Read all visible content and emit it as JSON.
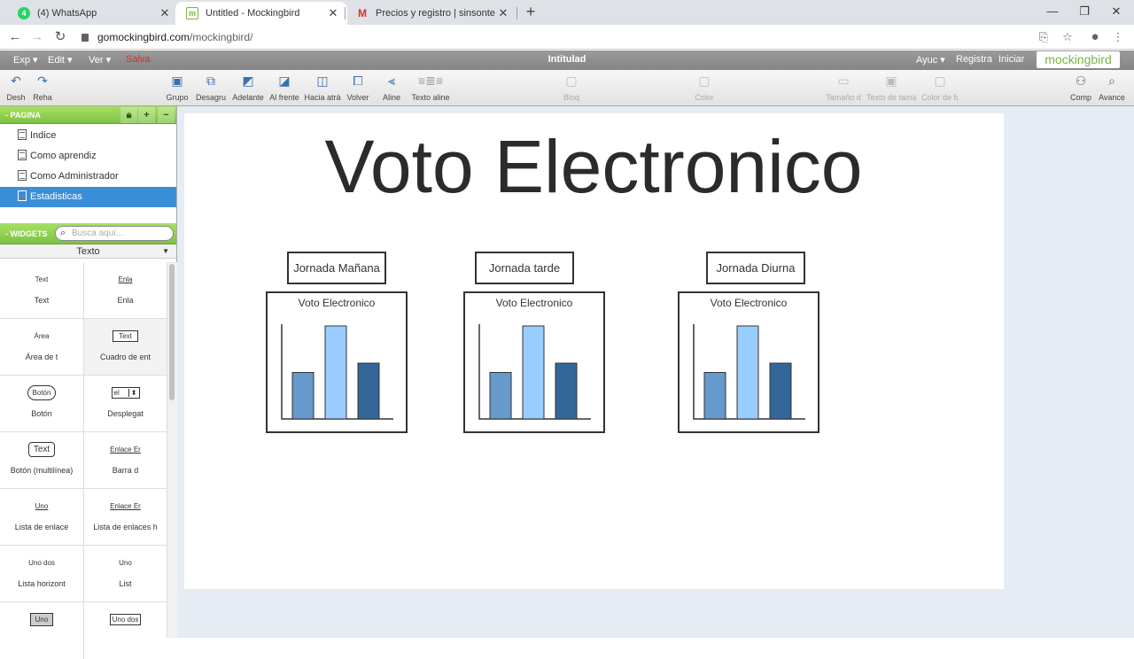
{
  "browser": {
    "tabs": [
      {
        "title": "(4) WhatsApp",
        "favicon": "whatsapp-icon",
        "badge": "4",
        "active": false
      },
      {
        "title": "Untitled - Mockingbird",
        "favicon": "mockingbird-icon",
        "badge": "m",
        "active": true
      },
      {
        "title": "Precios y registro | sinsonte",
        "favicon": "gmail-icon",
        "badge": "M",
        "active": false
      }
    ],
    "url_host": "gomockingbird.com",
    "url_path": "/mockingbird/"
  },
  "menubar": {
    "items": [
      "Exp ▾",
      "Edit ▾",
      "Ver ▾"
    ],
    "save_label": "Salva",
    "doc_title": "Intitulad",
    "right_items": [
      "Ayuc ▾",
      "Registra",
      "Iniciar"
    ],
    "brand": "mockingbird"
  },
  "toolbar": {
    "undo": "Desh",
    "redo": "Reha",
    "group": "Grupo",
    "ungroup": "Desagru",
    "forward": "Adelante",
    "to_front": "Al frente",
    "backward": "Hacia atrá",
    "to_back": "Volver",
    "align": "Aline",
    "text_align": "Texto aline",
    "lock": "Bloq",
    "color": "Color",
    "size": "Tamaño d",
    "text_size": "Texto de tama",
    "font_color": "Color de fu",
    "comp": "Comp",
    "advance": "Avance"
  },
  "pages": {
    "header": "PAGINA",
    "items": [
      "Indice",
      "Como aprendiz",
      "Como Administrador",
      "Estadisticas"
    ],
    "selected": "Estadisticas"
  },
  "widgets": {
    "header": "WIDGETS",
    "search_placeholder": "Busca aquí...",
    "category": "Texto",
    "items": [
      {
        "label": "Text",
        "preview": "Text"
      },
      {
        "label": "Enla",
        "preview": "Enla"
      },
      {
        "label": "Área de t",
        "preview": "Área"
      },
      {
        "label": "Cuadro de ent",
        "preview": "Text"
      },
      {
        "label": "Botón",
        "preview": "Botón"
      },
      {
        "label": "Desplegat",
        "preview": "el"
      },
      {
        "label": "Botón (multilínea)",
        "preview": "Text"
      },
      {
        "label": "Barra d",
        "preview": "Enlace Er"
      },
      {
        "label": "Lista de enlace",
        "preview": "Uno"
      },
      {
        "label": "Lista de enlaces h",
        "preview": "Enlace Er"
      },
      {
        "label": "Lista horizont",
        "preview": "Uno dos"
      },
      {
        "label": "List",
        "preview": "Uno"
      },
      {
        "label": "",
        "preview": "Uno"
      },
      {
        "label": "",
        "preview": "Uno dos"
      }
    ]
  },
  "canvas": {
    "title": "Voto Electronico",
    "labels": [
      "Jornada Mañana",
      "Jornada tarde",
      "Jornada Diurna"
    ],
    "chart_title": "Voto Electronico"
  },
  "chart_data": [
    {
      "type": "bar",
      "title": "Voto Electronico",
      "categories": [
        "",
        "",
        ""
      ],
      "values": [
        50,
        100,
        60
      ],
      "colors": [
        "#6699cc",
        "#99ccff",
        "#336699"
      ],
      "ylim": [
        0,
        100
      ]
    },
    {
      "type": "bar",
      "title": "Voto Electronico",
      "categories": [
        "",
        "",
        ""
      ],
      "values": [
        50,
        100,
        60
      ],
      "colors": [
        "#6699cc",
        "#99ccff",
        "#336699"
      ],
      "ylim": [
        0,
        100
      ]
    },
    {
      "type": "bar",
      "title": "Voto Electronico",
      "categories": [
        "",
        "",
        ""
      ],
      "values": [
        50,
        100,
        60
      ],
      "colors": [
        "#6699cc",
        "#99ccff",
        "#336699"
      ],
      "ylim": [
        0,
        100
      ]
    }
  ]
}
